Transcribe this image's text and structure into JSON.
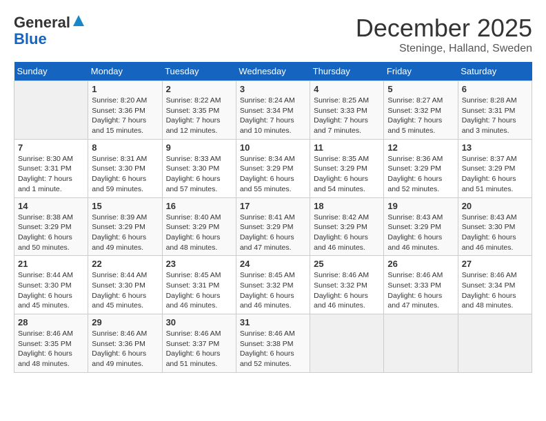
{
  "header": {
    "logo_general": "General",
    "logo_blue": "Blue",
    "month_title": "December 2025",
    "location": "Steninge, Halland, Sweden"
  },
  "days_of_week": [
    "Sunday",
    "Monday",
    "Tuesday",
    "Wednesday",
    "Thursday",
    "Friday",
    "Saturday"
  ],
  "weeks": [
    [
      {
        "day": "",
        "info": ""
      },
      {
        "day": "1",
        "info": "Sunrise: 8:20 AM\nSunset: 3:36 PM\nDaylight: 7 hours\nand 15 minutes."
      },
      {
        "day": "2",
        "info": "Sunrise: 8:22 AM\nSunset: 3:35 PM\nDaylight: 7 hours\nand 12 minutes."
      },
      {
        "day": "3",
        "info": "Sunrise: 8:24 AM\nSunset: 3:34 PM\nDaylight: 7 hours\nand 10 minutes."
      },
      {
        "day": "4",
        "info": "Sunrise: 8:25 AM\nSunset: 3:33 PM\nDaylight: 7 hours\nand 7 minutes."
      },
      {
        "day": "5",
        "info": "Sunrise: 8:27 AM\nSunset: 3:32 PM\nDaylight: 7 hours\nand 5 minutes."
      },
      {
        "day": "6",
        "info": "Sunrise: 8:28 AM\nSunset: 3:31 PM\nDaylight: 7 hours\nand 3 minutes."
      }
    ],
    [
      {
        "day": "7",
        "info": "Sunrise: 8:30 AM\nSunset: 3:31 PM\nDaylight: 7 hours\nand 1 minute."
      },
      {
        "day": "8",
        "info": "Sunrise: 8:31 AM\nSunset: 3:30 PM\nDaylight: 6 hours\nand 59 minutes."
      },
      {
        "day": "9",
        "info": "Sunrise: 8:33 AM\nSunset: 3:30 PM\nDaylight: 6 hours\nand 57 minutes."
      },
      {
        "day": "10",
        "info": "Sunrise: 8:34 AM\nSunset: 3:29 PM\nDaylight: 6 hours\nand 55 minutes."
      },
      {
        "day": "11",
        "info": "Sunrise: 8:35 AM\nSunset: 3:29 PM\nDaylight: 6 hours\nand 54 minutes."
      },
      {
        "day": "12",
        "info": "Sunrise: 8:36 AM\nSunset: 3:29 PM\nDaylight: 6 hours\nand 52 minutes."
      },
      {
        "day": "13",
        "info": "Sunrise: 8:37 AM\nSunset: 3:29 PM\nDaylight: 6 hours\nand 51 minutes."
      }
    ],
    [
      {
        "day": "14",
        "info": "Sunrise: 8:38 AM\nSunset: 3:29 PM\nDaylight: 6 hours\nand 50 minutes."
      },
      {
        "day": "15",
        "info": "Sunrise: 8:39 AM\nSunset: 3:29 PM\nDaylight: 6 hours\nand 49 minutes."
      },
      {
        "day": "16",
        "info": "Sunrise: 8:40 AM\nSunset: 3:29 PM\nDaylight: 6 hours\nand 48 minutes."
      },
      {
        "day": "17",
        "info": "Sunrise: 8:41 AM\nSunset: 3:29 PM\nDaylight: 6 hours\nand 47 minutes."
      },
      {
        "day": "18",
        "info": "Sunrise: 8:42 AM\nSunset: 3:29 PM\nDaylight: 6 hours\nand 46 minutes."
      },
      {
        "day": "19",
        "info": "Sunrise: 8:43 AM\nSunset: 3:29 PM\nDaylight: 6 hours\nand 46 minutes."
      },
      {
        "day": "20",
        "info": "Sunrise: 8:43 AM\nSunset: 3:30 PM\nDaylight: 6 hours\nand 46 minutes."
      }
    ],
    [
      {
        "day": "21",
        "info": "Sunrise: 8:44 AM\nSunset: 3:30 PM\nDaylight: 6 hours\nand 45 minutes."
      },
      {
        "day": "22",
        "info": "Sunrise: 8:44 AM\nSunset: 3:30 PM\nDaylight: 6 hours\nand 45 minutes."
      },
      {
        "day": "23",
        "info": "Sunrise: 8:45 AM\nSunset: 3:31 PM\nDaylight: 6 hours\nand 46 minutes."
      },
      {
        "day": "24",
        "info": "Sunrise: 8:45 AM\nSunset: 3:32 PM\nDaylight: 6 hours\nand 46 minutes."
      },
      {
        "day": "25",
        "info": "Sunrise: 8:46 AM\nSunset: 3:32 PM\nDaylight: 6 hours\nand 46 minutes."
      },
      {
        "day": "26",
        "info": "Sunrise: 8:46 AM\nSunset: 3:33 PM\nDaylight: 6 hours\nand 47 minutes."
      },
      {
        "day": "27",
        "info": "Sunrise: 8:46 AM\nSunset: 3:34 PM\nDaylight: 6 hours\nand 48 minutes."
      }
    ],
    [
      {
        "day": "28",
        "info": "Sunrise: 8:46 AM\nSunset: 3:35 PM\nDaylight: 6 hours\nand 48 minutes."
      },
      {
        "day": "29",
        "info": "Sunrise: 8:46 AM\nSunset: 3:36 PM\nDaylight: 6 hours\nand 49 minutes."
      },
      {
        "day": "30",
        "info": "Sunrise: 8:46 AM\nSunset: 3:37 PM\nDaylight: 6 hours\nand 51 minutes."
      },
      {
        "day": "31",
        "info": "Sunrise: 8:46 AM\nSunset: 3:38 PM\nDaylight: 6 hours\nand 52 minutes."
      },
      {
        "day": "",
        "info": ""
      },
      {
        "day": "",
        "info": ""
      },
      {
        "day": "",
        "info": ""
      }
    ]
  ]
}
